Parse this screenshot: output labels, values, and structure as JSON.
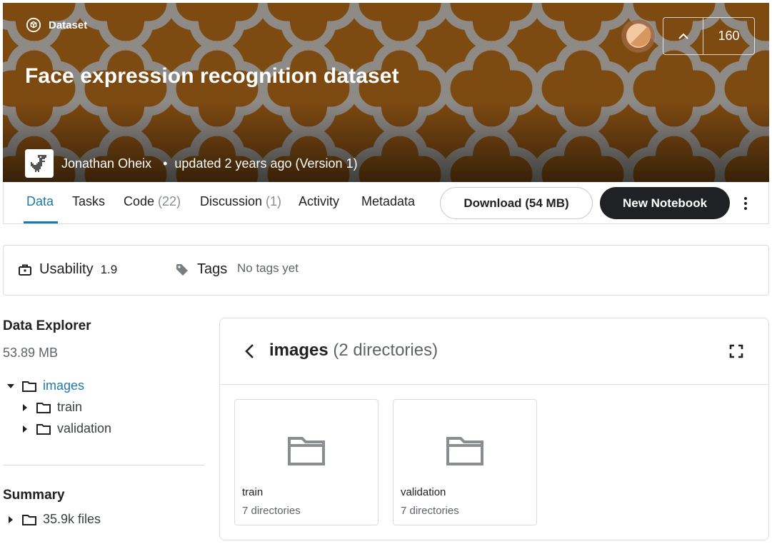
{
  "banner": {
    "type_label": "Dataset",
    "title": "Face expression recognition dataset",
    "author": "Jonathan Oheix",
    "dot": "•",
    "updated": "updated 2 years ago (Version 1)",
    "upvotes": "160",
    "colors": {
      "background": "#7d4a12",
      "pattern": "#8e8a86"
    }
  },
  "tabs": [
    {
      "label": "Data",
      "count": ""
    },
    {
      "label": "Tasks",
      "count": ""
    },
    {
      "label": "Code",
      "count": "(22)"
    },
    {
      "label": "Discussion",
      "count": "(1)"
    },
    {
      "label": "Activity",
      "count": ""
    },
    {
      "label": "Metadata",
      "count": ""
    }
  ],
  "actions": {
    "download": "Download (54 MB)",
    "new_notebook": "New Notebook"
  },
  "usability": {
    "label": "Usability",
    "score": "1.9",
    "tags_label": "Tags",
    "tags_value": "No tags yet"
  },
  "explorer": {
    "title": "Data Explorer",
    "size": "53.89 MB",
    "tree": [
      {
        "label": "images",
        "expanded": true
      },
      {
        "label": "train",
        "expanded": false
      },
      {
        "label": "validation",
        "expanded": false
      }
    ],
    "summary_title": "Summary",
    "summary_files": "35.9k files"
  },
  "panel": {
    "folder": "images",
    "count": "(2 directories)",
    "cards": [
      {
        "name": "train",
        "meta": "7 directories"
      },
      {
        "name": "validation",
        "meta": "7 directories"
      }
    ]
  },
  "accent_color": "#1e79a8"
}
